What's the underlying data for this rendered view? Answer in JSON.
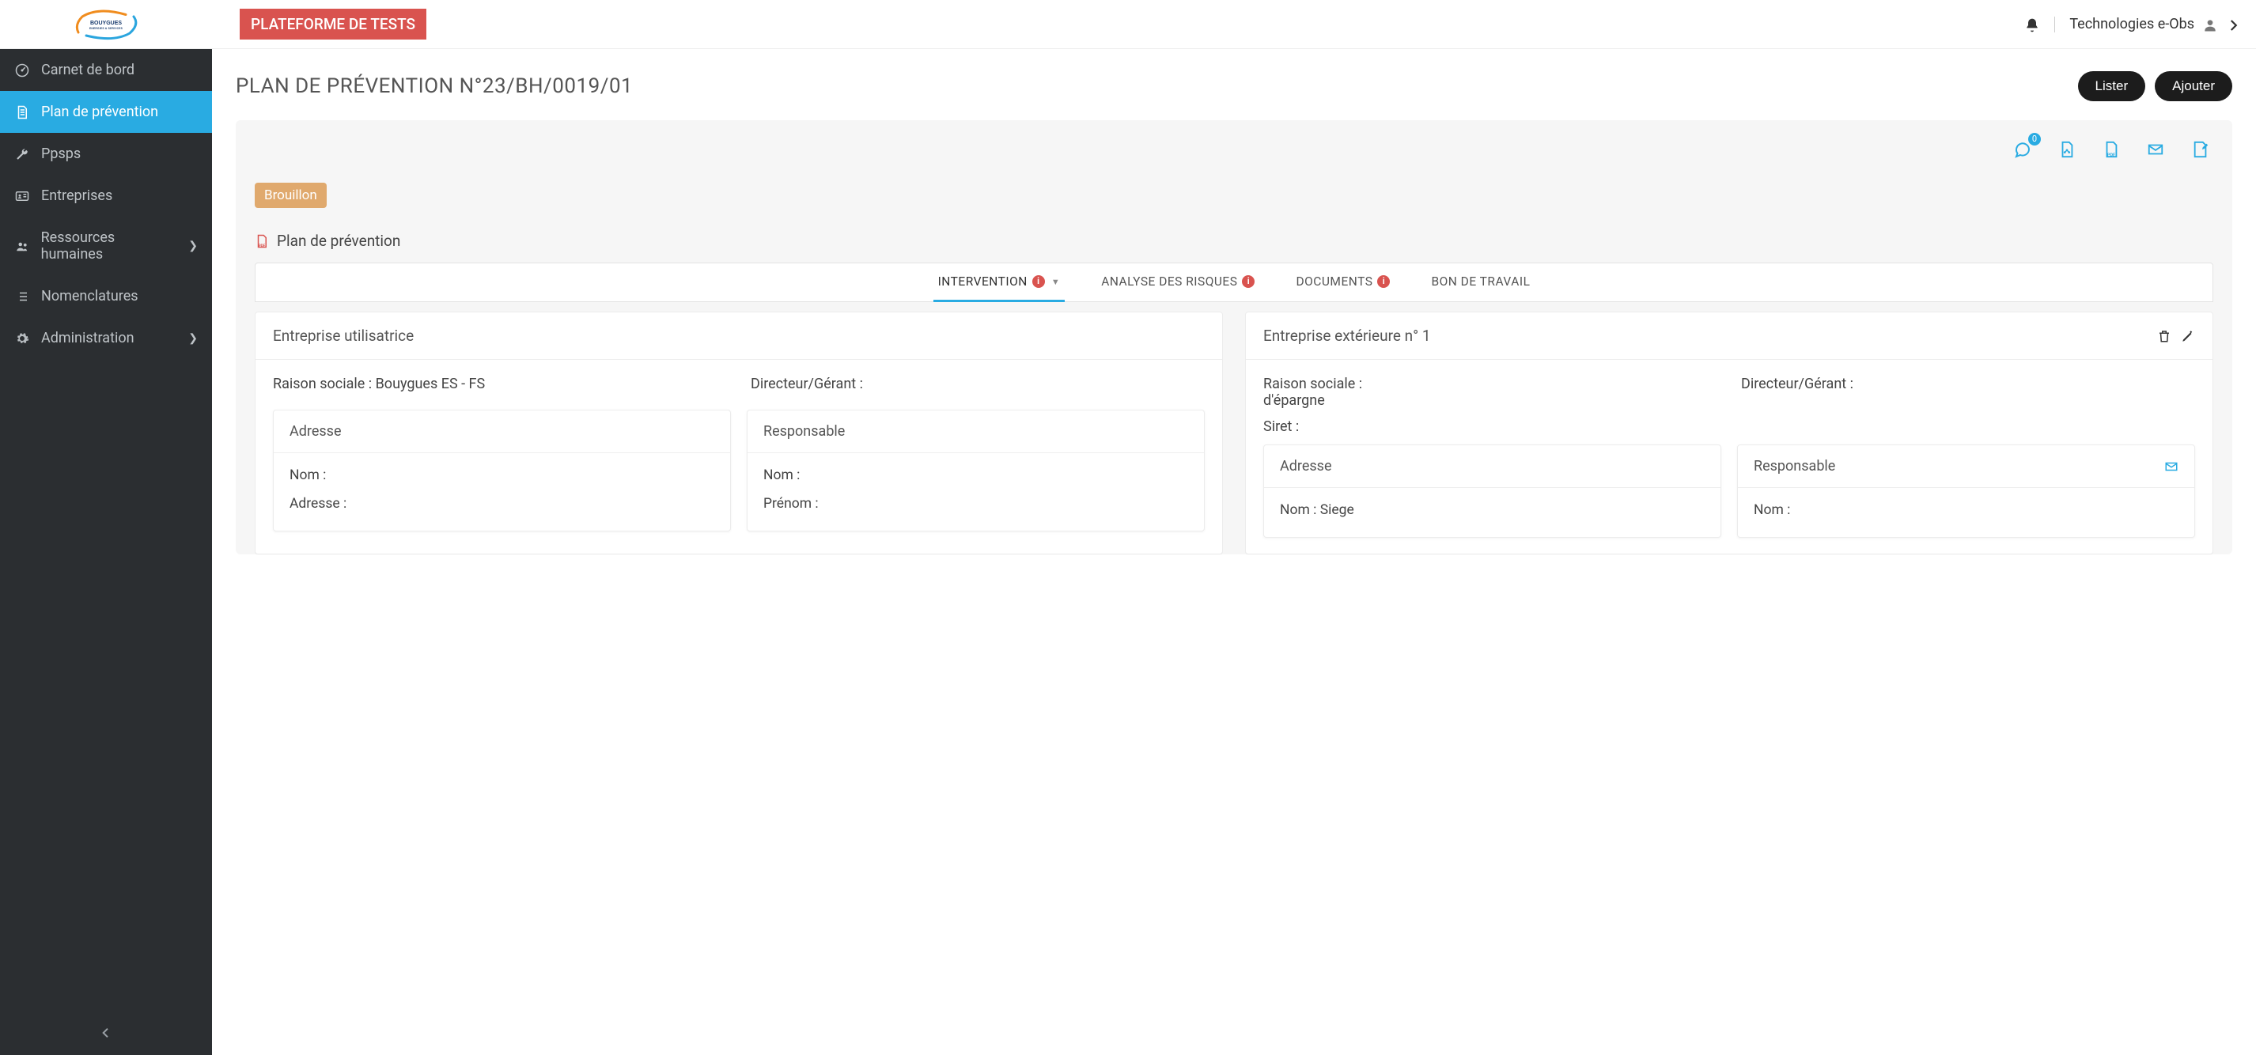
{
  "header": {
    "test_badge": "PLATEFORME DE TESTS",
    "user_label": "Technologies e-Obs"
  },
  "sidebar": {
    "items": [
      {
        "label": "Carnet de bord",
        "icon": "dashboard-icon",
        "has_children": false
      },
      {
        "label": "Plan de prévention",
        "icon": "document-icon",
        "has_children": false,
        "active": true
      },
      {
        "label": "Ppsps",
        "icon": "wrench-icon",
        "has_children": false
      },
      {
        "label": "Entreprises",
        "icon": "id-card-icon",
        "has_children": false
      },
      {
        "label": "Ressources humaines",
        "icon": "people-icon",
        "has_children": true
      },
      {
        "label": "Nomenclatures",
        "icon": "list-icon",
        "has_children": false
      },
      {
        "label": "Administration",
        "icon": "gear-icon",
        "has_children": true
      }
    ]
  },
  "page": {
    "title": "PLAN DE PRÉVENTION N°23/BH/0019/01",
    "actions": {
      "list": "Lister",
      "add": "Ajouter"
    }
  },
  "toolbar": {
    "comment_badge": "0"
  },
  "status": "Brouillon",
  "section": {
    "title": "Plan de prévention"
  },
  "tabs": [
    {
      "label": "INTERVENTION",
      "has_info": true,
      "has_caret": true,
      "active": true
    },
    {
      "label": "ANALYSE DES RISQUES",
      "has_info": true,
      "has_caret": false,
      "active": false
    },
    {
      "label": "DOCUMENTS",
      "has_info": true,
      "has_caret": false,
      "active": false
    },
    {
      "label": "BON DE TRAVAIL",
      "has_info": false,
      "has_caret": false,
      "active": false
    }
  ],
  "cards": {
    "eu": {
      "title": "Entreprise utilisatrice",
      "raison_sociale_label": "Raison sociale :",
      "raison_sociale_value": "Bouygues ES - FS",
      "directeur_label": "Directeur/Gérant :",
      "adresse": {
        "title": "Adresse",
        "nom_label": "Nom :",
        "adresse_label": "Adresse :"
      },
      "responsable": {
        "title": "Responsable",
        "nom_label": "Nom :",
        "prenom_label": "Prénom :"
      }
    },
    "ee": {
      "title": "Entreprise extérieure n° 1",
      "raison_sociale_label": "Raison sociale :",
      "raison_sociale_value": "d'épargne",
      "directeur_label": "Directeur/Gérant :",
      "siret_label": "Siret :",
      "adresse": {
        "title": "Adresse",
        "nom_label": "Nom :",
        "nom_value": "Siege"
      },
      "responsable": {
        "title": "Responsable",
        "nom_label": "Nom :"
      }
    }
  }
}
